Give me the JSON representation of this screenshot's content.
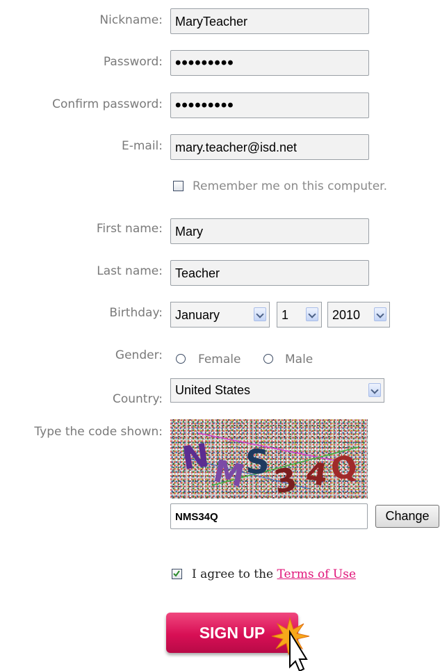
{
  "form": {
    "nickname": {
      "label": "Nickname:",
      "value": "MaryTeacher"
    },
    "password": {
      "label": "Password:",
      "value": "•••••••••"
    },
    "confirm_password": {
      "label": "Confirm password:",
      "value": "•••••••••"
    },
    "email": {
      "label": "E-mail:",
      "value": "mary.teacher@isd.net"
    },
    "remember_me": {
      "label": "Remember me on this computer.",
      "checked": false
    },
    "first_name": {
      "label": "First name:",
      "value": "Mary"
    },
    "last_name": {
      "label": "Last name:",
      "value": "Teacher"
    },
    "birthday": {
      "label": "Birthday:",
      "month": "January",
      "day": "1",
      "year": "2010"
    },
    "gender": {
      "label": "Gender:",
      "options": [
        "Female",
        "Male"
      ],
      "selected": null
    },
    "country": {
      "label": "Country:",
      "value": "United States"
    },
    "captcha": {
      "label": "Type the code shown:",
      "image_text": "NMS34Q",
      "input_value": "NMS34Q",
      "change_label": "Change"
    },
    "terms": {
      "prefix": "I agree to the ",
      "link": "Terms of Use",
      "checked": true
    },
    "signup_label": "SIGN UP"
  },
  "colors": {
    "label": "#7a7a7a",
    "link": "#e0147a",
    "button": "#d80f55"
  }
}
